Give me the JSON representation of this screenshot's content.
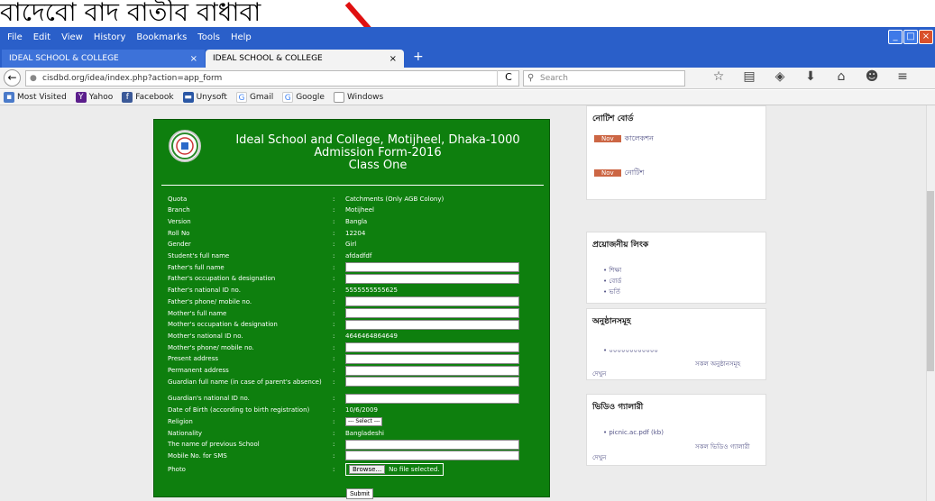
{
  "annotation": {
    "text": "বাদেবো বাদ বাতীব বাধাবা",
    "arrow_color": "#e01010"
  },
  "menubar": {
    "items": [
      "File",
      "Edit",
      "View",
      "History",
      "Bookmarks",
      "Tools",
      "Help"
    ]
  },
  "tabs": [
    {
      "label": "IDEAL SCHOOL & COLLEGE",
      "close": "×"
    },
    {
      "label": "IDEAL SCHOOL & COLLEGE",
      "close": "×"
    }
  ],
  "newtab_label": "+",
  "navbar": {
    "url": "cisdbd.org/idea/index.php?action=app_form",
    "reload": "C",
    "search_placeholder": "Search"
  },
  "bookmarks": [
    {
      "label": "Most Visited",
      "icon": "folder-icon",
      "color": "#4a7ac9"
    },
    {
      "label": "Yahoo",
      "icon": "yahoo-icon",
      "color": "#5b1e8c"
    },
    {
      "label": "Facebook",
      "icon": "facebook-icon",
      "color": "#3b5998"
    },
    {
      "label": "Unysoft",
      "icon": "unysoft-icon",
      "color": "#2a57a5"
    },
    {
      "label": "Gmail",
      "icon": "google-icon",
      "color": "#4285f4"
    },
    {
      "label": "Google",
      "icon": "google-icon",
      "color": "#4285f4"
    },
    {
      "label": "Windows",
      "icon": "windows-icon",
      "color": "#999999"
    }
  ],
  "form": {
    "title_line1": "Ideal School and College, Motijheel, Dhaka-1000",
    "title_line2": "Admission Form-2016",
    "title_line3": "Class One",
    "fields": [
      {
        "label": "Quota",
        "value": "Catchments (Only AGB Colony)"
      },
      {
        "label": "Branch",
        "value": "Motijheel"
      },
      {
        "label": "Version",
        "value": "Bangla"
      },
      {
        "label": "Roll No",
        "value": "12204"
      },
      {
        "label": "Gender",
        "value": "Girl"
      },
      {
        "label": "Student's full name",
        "value": "afdadfdf"
      },
      {
        "label": "Father's full name",
        "value": ""
      },
      {
        "label": "Father's occupation & designation",
        "value": ""
      },
      {
        "label": "Father's national ID no.",
        "value": "5555555555625"
      },
      {
        "label": "Father's phone/ mobile no.",
        "value": ""
      },
      {
        "label": "Mother's full name",
        "value": ""
      },
      {
        "label": "Mother's occupation & designation",
        "value": ""
      },
      {
        "label": "Mother's national ID no.",
        "value": "4646464864649"
      },
      {
        "label": "Mother's phone/ mobile no.",
        "value": ""
      },
      {
        "label": "Present address",
        "value": ""
      },
      {
        "label": "Permanent address",
        "value": ""
      },
      {
        "label": "Guardian full name (in case of parent's absence)",
        "value": ""
      },
      {
        "label": "Guardian's national ID no.",
        "value": ""
      },
      {
        "label": "Date of Birth (according to birth registration)",
        "value": "10/6/2009"
      },
      {
        "label": "Religion",
        "value": "--- Select ---"
      },
      {
        "label": "Nationality",
        "value": "Bangladeshi"
      },
      {
        "label": "The name of previous School",
        "value": ""
      },
      {
        "label": "Mobile No. for SMS",
        "value": ""
      },
      {
        "label": "Photo",
        "value": ""
      }
    ],
    "browse_label": "Browse...",
    "file_status": "No file selected.",
    "submit_label": "Submit"
  },
  "sidebar": {
    "notice": {
      "title": "নোটিশ বোর্ড",
      "items": [
        {
          "badge": "Nov",
          "text": "কালেকশন"
        },
        {
          "badge": "Nov",
          "text": "নোটিশ"
        }
      ]
    },
    "links": {
      "title": "প্রয়োজনীয় লিংক",
      "items": [
        "শিক্ষা",
        "বোর্ড",
        "ভর্তি"
      ]
    },
    "events": {
      "title": "অনুষ্ঠানসমূহ",
      "item": "০০০০০০০০০০০০",
      "more": "সকল অনুষ্ঠানসমূহ",
      "footer": "দেখুন"
    },
    "videos": {
      "title": "ভিডিও গ্যালারী",
      "item": "picnic.ac.pdf (kb)",
      "more": "সকল ভিডিও গ্যালারী",
      "footer": "দেখুন"
    }
  }
}
